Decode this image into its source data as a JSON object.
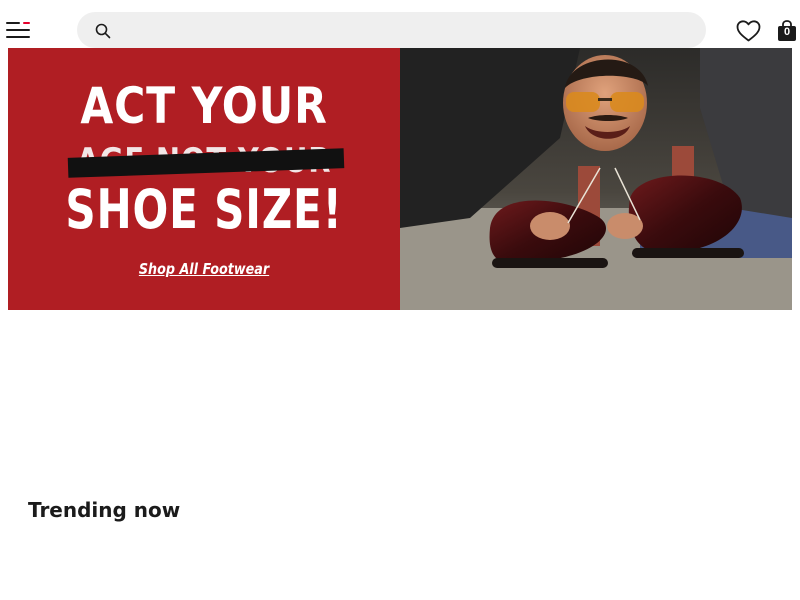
{
  "header": {
    "cart_count": "0",
    "search_placeholder": ""
  },
  "hero": {
    "line1": "ACT YOUR",
    "line2": "AGE NOT YOUR",
    "line3": "SHOE SIZE!",
    "cta": "Shop All Footwear"
  },
  "sections": {
    "trending_title": "Trending now"
  },
  "colors": {
    "accent_red": "#e4002b",
    "banner_red": "#b01e23"
  },
  "icons": [
    "menu-icon",
    "search-icon",
    "heart-icon",
    "bag-icon"
  ]
}
